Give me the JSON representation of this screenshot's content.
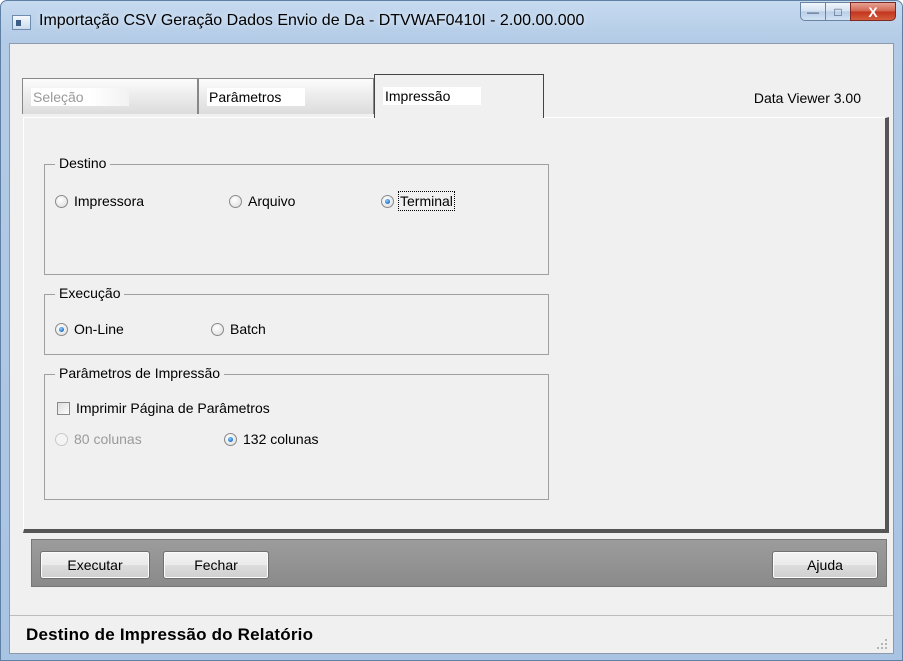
{
  "window": {
    "title": "Importação CSV Geração Dados Envio de Da - DTVWAF0410I - 2.00.00.000",
    "minimize_label": "—",
    "maximize_label": "□",
    "close_label": "X"
  },
  "tabs": [
    {
      "label": "Seleção",
      "state": "disabled"
    },
    {
      "label": "Parâmetros",
      "state": "normal"
    },
    {
      "label": "Impressão",
      "state": "active"
    }
  ],
  "version_label": "Data Viewer 3.00",
  "destino": {
    "title": "Destino",
    "options": [
      {
        "label": "Impressora",
        "checked": false
      },
      {
        "label": "Arquivo",
        "checked": false
      },
      {
        "label": "Terminal",
        "checked": true
      }
    ]
  },
  "execucao": {
    "title": "Execução",
    "options": [
      {
        "label": "On-Line",
        "checked": true
      },
      {
        "label": "Batch",
        "checked": false
      }
    ]
  },
  "parametros_impressao": {
    "title": "Parâmetros de Impressão",
    "checkbox_label": "Imprimir Página de Parâmetros",
    "checkbox_checked": false,
    "options": [
      {
        "label": "80 colunas",
        "checked": false,
        "disabled": true
      },
      {
        "label": "132 colunas",
        "checked": true,
        "disabled": false
      }
    ]
  },
  "buttons": {
    "executar": "Executar",
    "fechar": "Fechar",
    "ajuda": "Ajuda"
  },
  "status": "Destino de Impressão do Relatório",
  "colors": {
    "title_bar": "#b3cbe6",
    "close_button": "#c2331d",
    "button_bar": "#8a8a8a",
    "radio_selected": "#1a6fc7"
  }
}
